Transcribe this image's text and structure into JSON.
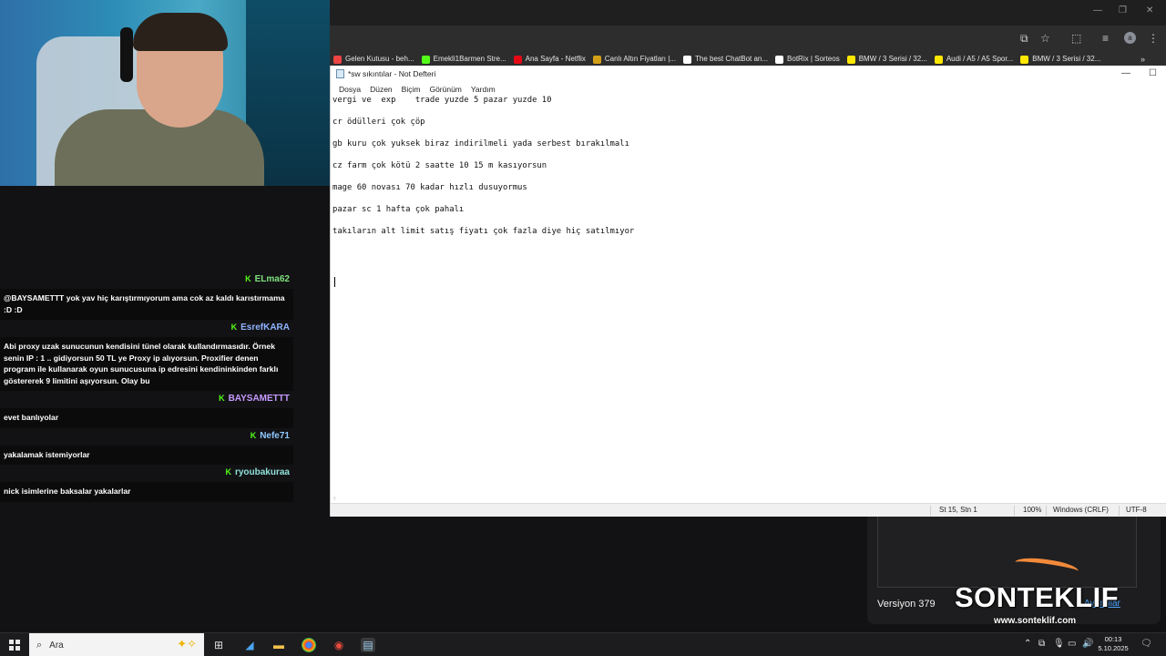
{
  "chat": {
    "messages": [
      {
        "user": "ELma62",
        "text": "@BAYSAMETTT yok yav hiç karıştırmıyorum ama cok az kaldı karıstırmama :D :D",
        "user_color": "#7ee07e"
      },
      {
        "user": "EsrefKARA",
        "text": "Abi proxy uzak sunucunun kendisini tünel olarak kullandırmasıdır. Örnek senin IP : 1 .. gidiyorsun 50 TL ye Proxy ip alıyorsun. Proxifier denen program ile kullanarak oyun sunucusuna ip edresini kendininkinden farklı göstererek 9 limitini aşıyorsun. Olay bu",
        "user_color": "#8fb3ff"
      },
      {
        "user": "BAYSAMETTT",
        "text": "evet banlıyolar",
        "user_color": "#c79bff"
      },
      {
        "user": "Nefe71",
        "text": "yakalamak istemiyorlar",
        "user_color": "#8fc8ff"
      },
      {
        "user": "ryoubakuraa",
        "text": "nick isimlerine baksalar yakalarlar",
        "user_color": "#8fe0d8"
      }
    ]
  },
  "browser": {
    "bookmarks": [
      {
        "label": "Gelen Kutusu - beh...",
        "icon": "mail-icon",
        "color": "#e44"
      },
      {
        "label": "Emekli1Barmen Stre...",
        "icon": "kick-icon",
        "color": "#53fc18"
      },
      {
        "label": "Ana Sayfa - Netflix",
        "icon": "netflix-icon",
        "color": "#e50914"
      },
      {
        "label": "Canlı Altın Fiyatları |...",
        "icon": "gold-icon",
        "color": "#d4a017"
      },
      {
        "label": "The best ChatBot an...",
        "icon": "chatbot-icon",
        "color": "#ffffff"
      },
      {
        "label": "BotRix | Sorteos",
        "icon": "botrix-icon",
        "color": "#ffffff"
      },
      {
        "label": "BMW / 3 Serisi / 32...",
        "icon": "sahibinden-icon",
        "color": "#ffe800"
      },
      {
        "label": "Audi / A5 / A5 Spor...",
        "icon": "sahibinden-icon",
        "color": "#ffe800"
      },
      {
        "label": "BMW / 3 Serisi / 32...",
        "icon": "sahibinden-icon",
        "color": "#ffe800"
      }
    ]
  },
  "notepad": {
    "title": "*sw sıkıntılar - Not Defteri",
    "menu": [
      "Dosya",
      "Düzen",
      "Biçim",
      "Görünüm",
      "Yardım"
    ],
    "lines": [
      "vergi ve  exp    trade yuzde 5 pazar yuzde 10",
      "cr ödülleri çok çöp",
      "gb kuru çok yuksek biraz indirilmeli yada serbest bırakılmalı",
      "cz farm çok kötü 2 saatte 10 15 m kasıyorsun",
      "mage 60 novası 70 kadar hızlı dusuyormus",
      "pazar sc 1 hafta çok pahalı",
      "takıların alt limit satış fiyatı çok fazla diye hiç satılmıyor"
    ],
    "status": {
      "position": "St 15, Stn 1",
      "zoom": "100%",
      "line_ending": "Windows (CRLF)",
      "encoding": "UTF-8"
    }
  },
  "widget": {
    "version": "Versiyon 379",
    "link": "Ayrıntılar"
  },
  "overlay_logo": {
    "text": "SONTEKLIF",
    "url": "www.sonteklif.com"
  },
  "taskbar": {
    "search_placeholder": "Ara",
    "time": "00:13",
    "date": "5.10.2025"
  }
}
